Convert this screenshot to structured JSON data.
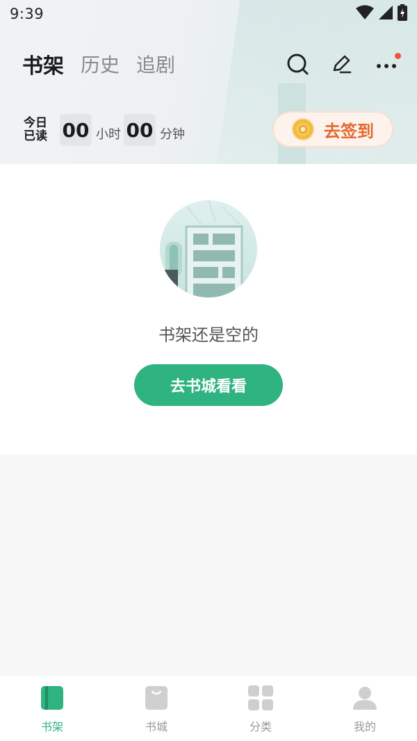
{
  "status_bar": {
    "time": "9:39",
    "icons": [
      "wifi-icon",
      "cellular-signal-icon",
      "battery-charging-icon"
    ]
  },
  "top_tabs": [
    {
      "label": "书架",
      "active": true
    },
    {
      "label": "历史",
      "active": false
    },
    {
      "label": "追剧",
      "active": false
    }
  ],
  "top_actions": {
    "icons": [
      "search-icon",
      "edit-icon",
      "more-icon"
    ],
    "notification_dot_color": "#f0553a"
  },
  "reading": {
    "label_line1": "今日",
    "label_line2": "已读",
    "hours": "00",
    "hours_unit": "小时",
    "minutes": "00",
    "minutes_unit": "分钟"
  },
  "checkin": {
    "label": "去签到",
    "icon": "gold-coin-icon",
    "color": "#e3682e"
  },
  "empty_state": {
    "message": "书架还是空的",
    "button_label": "去书城看看",
    "button_color": "#2fb380"
  },
  "bottom_nav": [
    {
      "label": "书架",
      "icon": "bookshelf-icon",
      "active": true
    },
    {
      "label": "书城",
      "icon": "bookstore-icon",
      "active": false
    },
    {
      "label": "分类",
      "icon": "category-grid-icon",
      "active": false
    },
    {
      "label": "我的",
      "icon": "profile-icon",
      "active": false
    }
  ],
  "colors": {
    "accent": "#2fb380",
    "inactive": "#999999"
  }
}
